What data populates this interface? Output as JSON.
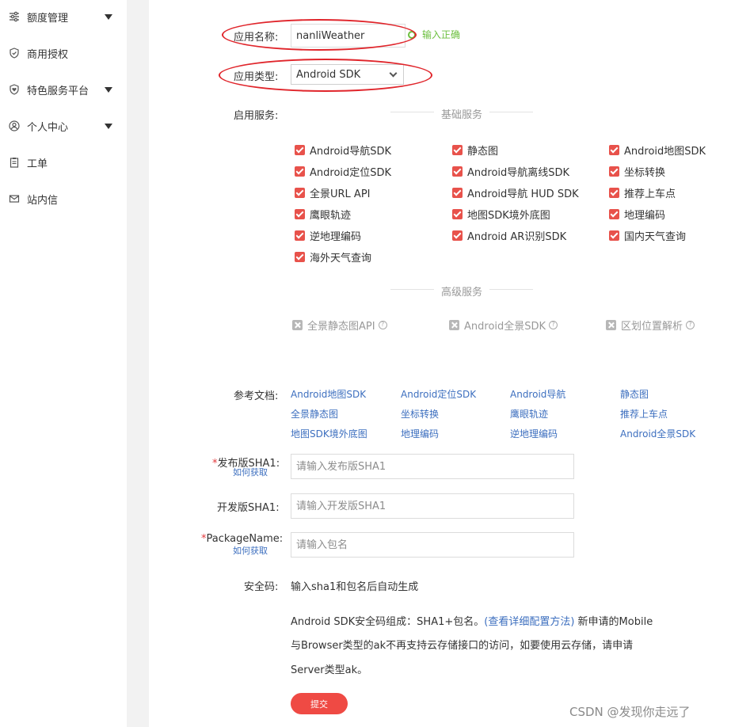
{
  "sidebar": {
    "items": [
      {
        "label": "额度管理",
        "icon": "sliders-icon",
        "has_caret": true
      },
      {
        "label": "商用授权",
        "icon": "shield-check-icon",
        "has_caret": false
      },
      {
        "label": "特色服务平台",
        "icon": "shield-heart-icon",
        "has_caret": true
      },
      {
        "label": "个人中心",
        "icon": "user-circle-icon",
        "has_caret": true
      },
      {
        "label": "工单",
        "icon": "clipboard-icon",
        "has_caret": false
      },
      {
        "label": "站内信",
        "icon": "mail-icon",
        "has_caret": false
      }
    ]
  },
  "form": {
    "app_name": {
      "label": "应用名称:",
      "value": "nanliWeather",
      "valid_text": "输入正确"
    },
    "app_type": {
      "label": "应用类型:",
      "selected": "Android SDK"
    },
    "services": {
      "label": "启用服务:",
      "basic_title": "基础服务",
      "basic": [
        [
          "Android导航SDK",
          "静态图",
          "Android地图SDK"
        ],
        [
          "Android定位SDK",
          "Android导航离线SDK",
          "坐标转换"
        ],
        [
          "全景URL API",
          "Android导航 HUD SDK",
          "推荐上车点"
        ],
        [
          "鹰眼轨迹",
          "地图SDK境外底图",
          "地理编码"
        ],
        [
          "逆地理编码",
          "Android AR识别SDK",
          "国内天气查询"
        ],
        [
          "海外天气查询"
        ]
      ],
      "advanced_title": "高级服务",
      "advanced": [
        "全景静态图API",
        "Android全景SDK",
        "区划位置解析"
      ]
    },
    "docs": {
      "label": "参考文档:",
      "rows": [
        [
          "Android地图SDK",
          "Android定位SDK",
          "Android导航",
          "静态图"
        ],
        [
          "全景静态图",
          "坐标转换",
          "鹰眼轨迹",
          "推荐上车点"
        ],
        [
          "地图SDK境外底图",
          "地理编码",
          "逆地理编码",
          "Android全景SDK"
        ]
      ]
    },
    "release_sha1": {
      "required_mark": "*",
      "label": "发布版SHA1:",
      "help_link": "如何获取",
      "placeholder": "请输入发布版SHA1"
    },
    "dev_sha1": {
      "label": "开发版SHA1:",
      "placeholder": "请输入开发版SHA1"
    },
    "package_name": {
      "required_mark": "*",
      "label": "PackageName:",
      "help_link": "如何获取",
      "placeholder": "请输入包名"
    },
    "security_code": {
      "label": "安全码:",
      "value": "输入sha1和包名后自动生成",
      "note_line1_pre": "Android SDK安全码组成：SHA1+包名。",
      "note_line1_link": "(查看详细配置方法)",
      "note_line1_post": " 新申请的Mobile",
      "note_line2": "与Browser类型的ak不再支持云存储接口的访问，如要使用云存储，请申请",
      "note_line3": "Server类型ak。"
    },
    "submit_label": "提交"
  },
  "watermark": "CSDN @发现你走远了",
  "colors": {
    "accent": "#ef4a44",
    "link": "#3d6fbf",
    "valid": "#6bbf3d",
    "annotation": "#e0252b"
  }
}
